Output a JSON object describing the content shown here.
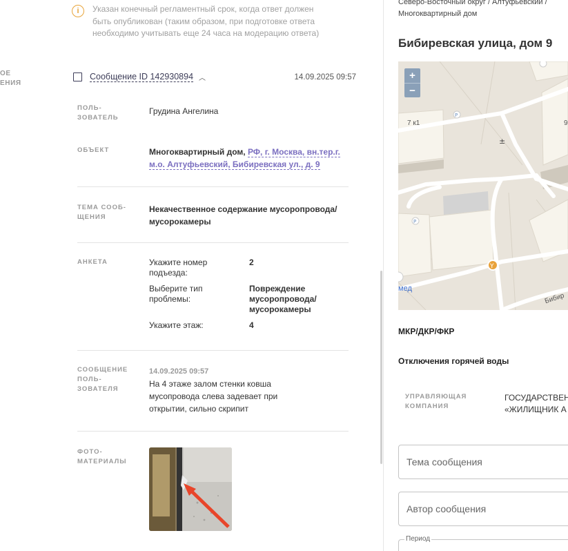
{
  "left_clipped_label": [
    "ОЕ",
    "ЕНИЯ"
  ],
  "notice": {
    "icon": "info-icon",
    "text": "Указан конечный регламентный срок, когда ответ должен быть опубликован (таким образом, при подготовке ответа необходимо учитывать еще 24 часа на модерацию ответа)"
  },
  "message": {
    "id_label": "Сообщение ID 142930894",
    "date": "14.09.2025 09:57",
    "user_label": "ПОЛЬ-\nЗОВАТЕЛЬ",
    "user_value": "Грудина Ангелина",
    "object_label": "ОБЪЕКТ",
    "object_type": "Многоквартирный дом,",
    "object_address": "РФ, г. Москва, вн.тер.г. м.о. Алтуфьевский, Бибиревская ул., д. 9",
    "topic_label": "ТЕМА СООБ-\nЩЕНИЯ",
    "topic_value": "Некачественное содержание мусоропровода/мусорокамеры",
    "survey_label": "АНКЕТА",
    "survey": [
      {
        "q": "Укажите номер подъезда:",
        "a": "2"
      },
      {
        "q": "Выберите тип проблемы:",
        "a": "Повреждение мусоропровода/ мусорокамеры"
      },
      {
        "q": "Укажите этаж:",
        "a": "4"
      }
    ],
    "user_msg_label": "СООБЩЕНИЕ\nПОЛЬ-\nЗОВАТЕЛЯ",
    "user_msg_ts": "14.09.2025 09:57",
    "user_msg_text": "На 4 этаже залом стенки ковша мусопровода слева задевает при открытии, сильно скрипит",
    "photo_label": "ФОТО-\nМАТЕРИАЛЫ"
  },
  "right_panel": {
    "breadcrumb": [
      "Северо-Восточный округ / Алтуфьевский /",
      "Многоквартирный дом"
    ],
    "address_title": "Бибиревская улица, дом 9",
    "map": {
      "zoom_in": "+",
      "zoom_out": "−",
      "label_building": "7 к1",
      "label_edge": "9",
      "label_street": "Бибир",
      "link_text": "мед"
    },
    "mkr_title": "МКР/ДКР/ФКР",
    "hot_water_title": "Отключения горячей воды",
    "company_label": "УПРАВЛЯЮЩАЯ КОМПАНИЯ",
    "company_value": [
      "ГОСУДАРСТВЕН",
      "«ЖИЛИЩНИК А"
    ],
    "topic_input_placeholder": "Тема сообщения",
    "author_input_placeholder": "Автор сообщения",
    "period_label": "Период"
  },
  "colors": {
    "accent_link": "#7b6fc0",
    "notice_icon": "#e8a43a",
    "map_bg": "#e9e4db"
  }
}
